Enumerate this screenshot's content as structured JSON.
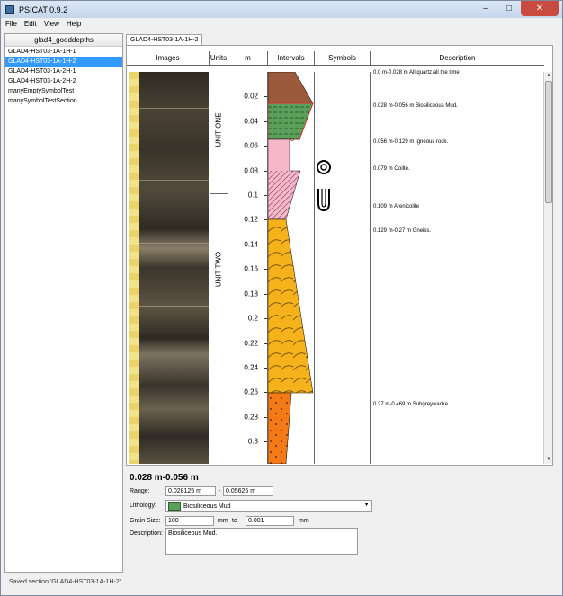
{
  "window": {
    "title": "PSICAT 0.9.2"
  },
  "menu": [
    "File",
    "Edit",
    "View",
    "Help"
  ],
  "sidebar": {
    "header": "glad4_gooddepths",
    "items": [
      {
        "label": "GLAD4-HST03-1A-1H-1",
        "selected": false
      },
      {
        "label": "GLAD4-HST03-1A-1H-2",
        "selected": true
      },
      {
        "label": "GLAD4-HST03-1A-2H-1",
        "selected": false
      },
      {
        "label": "GLAD4-HST03-1A-2H-2",
        "selected": false
      },
      {
        "label": "manyEmptySymbolTest",
        "selected": false
      },
      {
        "label": "manySymbolTestSection",
        "selected": false
      }
    ]
  },
  "status": "Saved section 'GLAD4-HST03-1A-1H-2'",
  "tab": {
    "label": "GLAD4-HST03-1A-1H-2"
  },
  "columns": {
    "images": "Images",
    "units": "Units",
    "depth": "m",
    "intervals": "Intervals",
    "symbols": "Symbols",
    "description": "Description"
  },
  "units": [
    "UNIT ONE",
    "UNIT TWO"
  ],
  "depth_ticks": [
    "0.02",
    "0.04",
    "0.06",
    "0.08",
    "0.1",
    "0.12",
    "0.14",
    "0.16",
    "0.18",
    "0.2",
    "0.22",
    "0.24",
    "0.26",
    "0.28",
    "0.3"
  ],
  "descriptions": [
    "0.0 m-0.028 m All quartz all the time.",
    "0.028 m-0.056 m Biosiliceous Mud.",
    "0.056 m-0.129 m Igneous rock.",
    "0.079 m Ooilte.",
    "0.109 m Arenicolite",
    "0.129 m-0.27 m Gneiss.",
    "0.27 m-0.469 m Subgreywacke."
  ],
  "symbol_icons": [
    "ooid-icon",
    "u-burrow-icon"
  ],
  "lithology_colors": {
    "quartz": "#9c5a3c",
    "mud": "#5aa05a",
    "igneous": "#f4b8c8",
    "gneiss": "#f5b21b",
    "subgreywacke": "#f47a18"
  },
  "detail": {
    "title": "0.028 m-0.056 m",
    "range_label": "Range:",
    "range_from": "0.028125 m",
    "range_sep": "-",
    "range_to": "0.05625 m",
    "lithology_label": "Lithology:",
    "lithology_value": "Biosiliceous Mud",
    "grain_label": "Grain Size:",
    "grain_from": "100",
    "grain_from_unit": "mm",
    "grain_to_label": "to",
    "grain_to": "0.001",
    "grain_to_unit": "mm",
    "description_label": "Description:",
    "description_value": "Biosiliceous Mud."
  }
}
